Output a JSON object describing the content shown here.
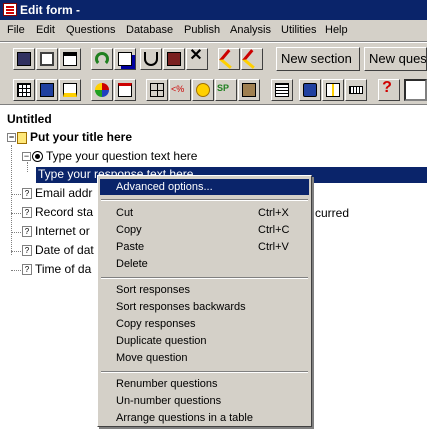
{
  "window": {
    "title": "Edit form -"
  },
  "menubar": [
    "File",
    "Edit",
    "Questions",
    "Database",
    "Publish",
    "Analysis",
    "Utilities",
    "Help"
  ],
  "toolbar": {
    "new_section_label": "New section",
    "new_question_label": "New ques"
  },
  "toolbar_icons": {
    "row1": [
      "save-icon",
      "print-icon",
      "preview-icon",
      "undo-icon",
      "copy-icon",
      "cut-icon",
      "paste-icon",
      "delete-icon",
      "highlight-icon",
      "check-icon"
    ],
    "row2": [
      "grid-icon",
      "database-icon",
      "table-icon",
      "palette-icon",
      "form-icon",
      "table-frame-icon",
      "percent-icon",
      "paint-icon",
      "spell-check-icon",
      "portrait-icon",
      "list-icon",
      "image-icon",
      "column-icon",
      "keyboard-icon",
      "help-icon"
    ]
  },
  "tree": {
    "root": "Untitled",
    "section_title": "Put your title here",
    "question": "Type your question text here",
    "selected_response": "Type your response text here",
    "items": [
      "Email addr",
      "Record sta",
      "Internet or",
      "Date of dat",
      "Time of da"
    ],
    "partial_right_text": "curred"
  },
  "context_menu": {
    "groups": [
      [
        {
          "label": "Advanced options...",
          "highlighted": true
        }
      ],
      [
        {
          "label": "Cut",
          "shortcut": "Ctrl+X"
        },
        {
          "label": "Copy",
          "shortcut": "Ctrl+C"
        },
        {
          "label": "Paste",
          "shortcut": "Ctrl+V"
        },
        {
          "label": "Delete"
        }
      ],
      [
        {
          "label": "Sort responses"
        },
        {
          "label": "Sort responses backwards"
        },
        {
          "label": "Copy responses"
        },
        {
          "label": "Duplicate question"
        },
        {
          "label": "Move question"
        }
      ],
      [
        {
          "label": "Renumber questions"
        },
        {
          "label": "Un-number questions"
        },
        {
          "label": "Arrange questions in a table"
        }
      ]
    ]
  },
  "colors": {
    "title_bg": "#0a246a",
    "chrome": "#d4d0c8",
    "selection": "#0a246a"
  }
}
